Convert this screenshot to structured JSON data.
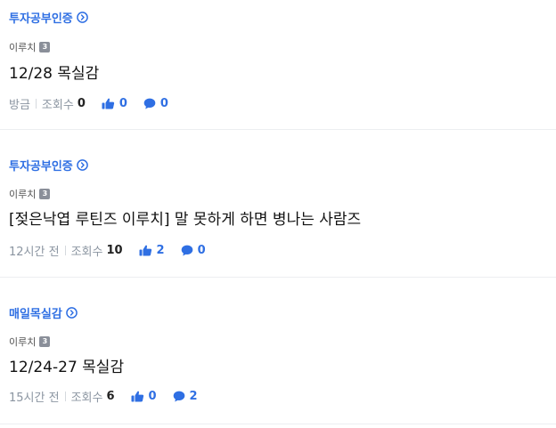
{
  "posts": [
    {
      "board": "투자공부인증",
      "author": "이루치",
      "level": "3",
      "title": "12/28 목실감",
      "time": "방금",
      "views_label": "조회수",
      "views": "0",
      "likes": "0",
      "comments": "0"
    },
    {
      "board": "투자공부인증",
      "author": "이루치",
      "level": "3",
      "title": "[젖은낙엽 루틴즈 이루치] 말 못하게 하면 병나는 사람즈",
      "time": "12시간 전",
      "views_label": "조회수",
      "views": "10",
      "likes": "2",
      "comments": "0"
    },
    {
      "board": "매일목실감",
      "author": "이루치",
      "level": "3",
      "title": "12/24-27 목실감",
      "time": "15시간 전",
      "views_label": "조회수",
      "views": "6",
      "likes": "0",
      "comments": "2"
    }
  ],
  "colors": {
    "accent": "#2f6fe3",
    "meta_gray": "#8b95a1",
    "badge_gray": "#8a8f99"
  },
  "icons": {
    "board_chevron": "chevron-right-circle-icon",
    "likes": "thumbs-up-icon",
    "comments": "speech-bubble-icon"
  }
}
